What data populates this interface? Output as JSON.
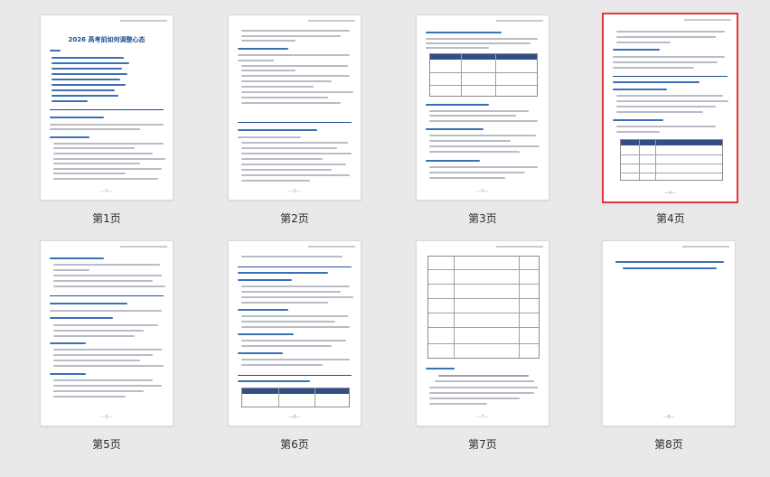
{
  "pages": [
    {
      "caption": "第1页",
      "page_label": "—1—",
      "title": "2026 高考前如何调整心态",
      "selected": false
    },
    {
      "caption": "第2页",
      "page_label": "—2—",
      "selected": false
    },
    {
      "caption": "第3页",
      "page_label": "—3—",
      "selected": false
    },
    {
      "caption": "第4页",
      "page_label": "—4—",
      "selected": true
    },
    {
      "caption": "第5页",
      "page_label": "—5—",
      "selected": false
    },
    {
      "caption": "第6页",
      "page_label": "—6—",
      "selected": false
    },
    {
      "caption": "第7页",
      "page_label": "—7—",
      "selected": false
    },
    {
      "caption": "第8页",
      "page_label": "—8—",
      "selected": false
    }
  ],
  "colors": {
    "selection_border": "#e0393b",
    "heading_blue": "#1f4e96",
    "table_header": "#2f4f86"
  }
}
